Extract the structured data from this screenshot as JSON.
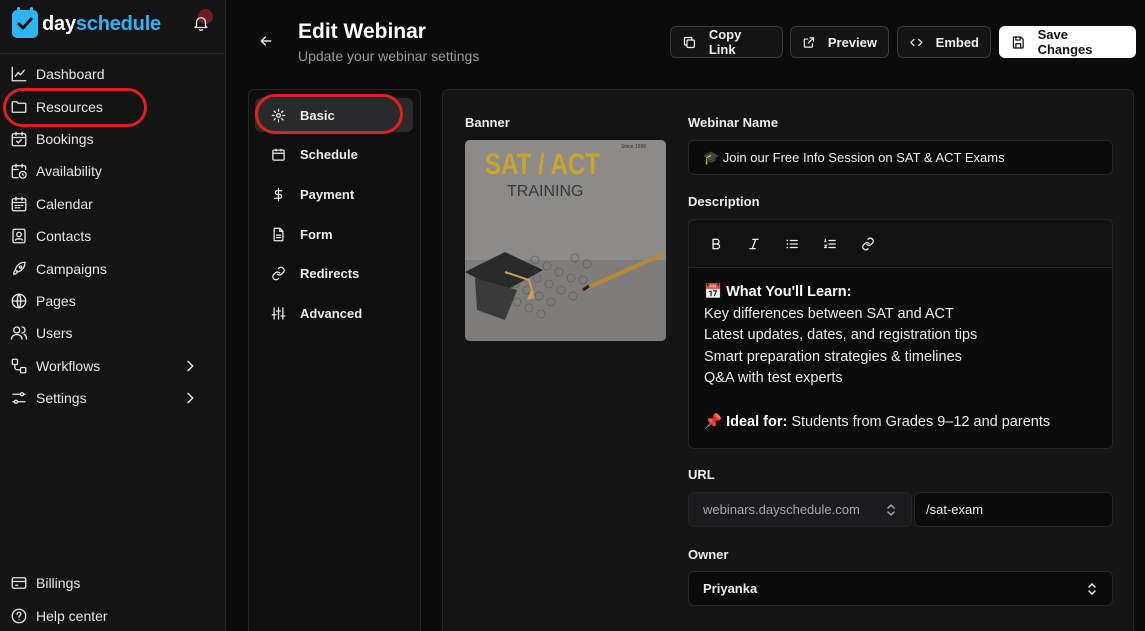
{
  "app": {
    "logo_day": "day",
    "logo_schedule": "schedule"
  },
  "sidebar": {
    "items": [
      {
        "label": "Dashboard",
        "icon": "chart-line-icon"
      },
      {
        "label": "Resources",
        "icon": "folder-icon"
      },
      {
        "label": "Bookings",
        "icon": "calendar-check-icon"
      },
      {
        "label": "Availability",
        "icon": "calendar-clock-icon"
      },
      {
        "label": "Calendar",
        "icon": "calendar-icon"
      },
      {
        "label": "Contacts",
        "icon": "contact-icon"
      },
      {
        "label": "Campaigns",
        "icon": "rocket-icon"
      },
      {
        "label": "Pages",
        "icon": "globe-icon"
      },
      {
        "label": "Users",
        "icon": "users-icon"
      },
      {
        "label": "Workflows",
        "icon": "workflow-icon"
      },
      {
        "label": "Settings",
        "icon": "sliders-icon"
      }
    ],
    "bottom": [
      {
        "label": "Billings",
        "icon": "credit-card-icon"
      },
      {
        "label": "Help center",
        "icon": "help-circle-icon"
      }
    ]
  },
  "header": {
    "title": "Edit Webinar",
    "subtitle": "Update your webinar settings",
    "buttons": {
      "copy_link": "Copy Link",
      "preview": "Preview",
      "embed": "Embed",
      "save": "Save Changes"
    }
  },
  "settings_menu": [
    {
      "label": "Basic",
      "icon": "gear-icon",
      "active": true
    },
    {
      "label": "Schedule",
      "icon": "calendar-icon",
      "active": false
    },
    {
      "label": "Payment",
      "icon": "dollar-icon",
      "active": false
    },
    {
      "label": "Form",
      "icon": "document-icon",
      "active": false
    },
    {
      "label": "Redirects",
      "icon": "link-icon",
      "active": false
    },
    {
      "label": "Advanced",
      "icon": "sliders-vertical-icon",
      "active": false
    }
  ],
  "form": {
    "banner_label": "Banner",
    "banner_image": {
      "heading": "SAT / ACT",
      "subheading": "TRAINING",
      "tag": "Since 1998"
    },
    "name_label": "Webinar Name",
    "name_value": "🎓 Join our Free Info Session on SAT & ACT Exams",
    "description_label": "Description",
    "description": {
      "heading_emoji": "📅",
      "heading": "What You'll Learn:",
      "lines": [
        "Key differences between SAT and ACT",
        "Latest updates, dates, and registration tips",
        "Smart preparation strategies & timelines",
        "Q&A with test experts"
      ],
      "ideal_emoji": "📌",
      "ideal_label": "Ideal for:",
      "ideal_text": " Students from Grades 9–12 and parents"
    },
    "url_label": "URL",
    "url_domain": "webinars.dayschedule.com",
    "url_slug": "/sat-exam",
    "owner_label": "Owner",
    "owner_value": "Priyanka"
  },
  "colors": {
    "brand": "#2bb6f5",
    "highlight": "#e0201a"
  }
}
